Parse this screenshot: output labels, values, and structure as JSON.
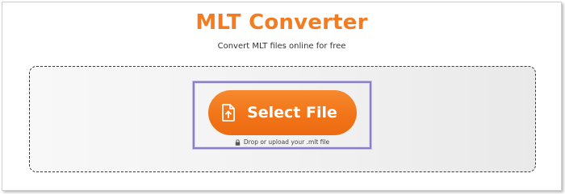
{
  "header": {
    "title": "MLT Converter",
    "subtitle": "Convert MLT files online for free"
  },
  "upload": {
    "button_label": "Select File",
    "button_icon": "file-upload-icon",
    "hint_text": "Drop or upload your .mlt file",
    "hint_icon": "lock-icon"
  },
  "colors": {
    "accent": "#f47920",
    "title": "#f47c20",
    "highlight_border": "#8a7fc4"
  }
}
